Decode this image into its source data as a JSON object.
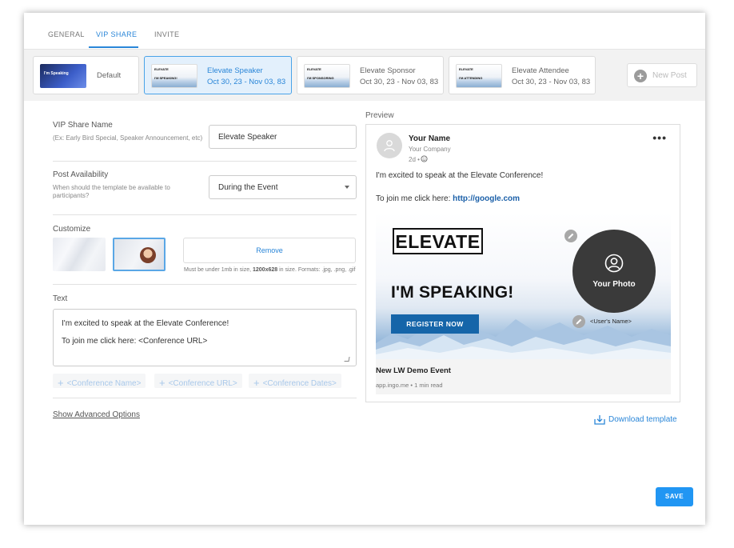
{
  "tabs": [
    {
      "label": "GENERAL"
    },
    {
      "label": "VIP SHARE"
    },
    {
      "label": "INVITE"
    }
  ],
  "cards": [
    {
      "label": "Default",
      "thumb_text": "I'm Speaking"
    },
    {
      "title": "Elevate Speaker",
      "date": "Oct 30, 23 - Nov 03, 83",
      "thumb_text": "I'M SPEAKING!"
    },
    {
      "title": "Elevate Sponsor",
      "date": "Oct 30, 23 - Nov 03, 83",
      "thumb_text": "I'M SPONSORING"
    },
    {
      "title": "Elevate Attendee",
      "date": "Oct 30, 23 - Nov 03, 83",
      "thumb_text": "I'M ATTENDING"
    }
  ],
  "thumb_logo": "ELEVATE",
  "new_post": "New Post",
  "form": {
    "name_label": "VIP Share Name",
    "name_hint": "(Ex: Early Bird Special, Speaker Announcement, etc)",
    "name_value": "Elevate Speaker",
    "avail_label": "Post Availability",
    "avail_hint": "When should the template be available to participants?",
    "avail_value": "During the Event",
    "customize_label": "Customize",
    "remove_label": "Remove",
    "hint_pre": "Must be under 1mb in size, ",
    "hint_bold": "1200x628",
    "hint_post": " in size. Formats: .jpg, .png, .gif",
    "text_label": "Text",
    "text_line1": "I'm excited to speak at the Elevate Conference!",
    "text_line2": "To join me click here: <Conference URL>",
    "chips": [
      "<Conference Name>",
      "<Conference URL>",
      "<Conference Dates>"
    ],
    "advanced": "Show Advanced Options"
  },
  "preview": {
    "label": "Preview",
    "name": "Your Name",
    "company": "Your Company",
    "time": "2d •",
    "line1": "I'm excited to speak at the Elevate Conference!",
    "line2_pre": "To join me click here: ",
    "line2_link": "http://google.com",
    "logo": "ELEVATE",
    "headline": "I'M SPEAKING!",
    "register": "REGISTER NOW",
    "photo_label": "Your Photo",
    "username": "<User's Name>",
    "event_title": "New LW Demo Event",
    "event_sub": "app.ingo.me • 1 min read"
  },
  "download": "Download template",
  "save": "SAVE",
  "colors": {
    "accent": "#2a86d8",
    "save": "#2196f3",
    "register": "#1565a9"
  }
}
